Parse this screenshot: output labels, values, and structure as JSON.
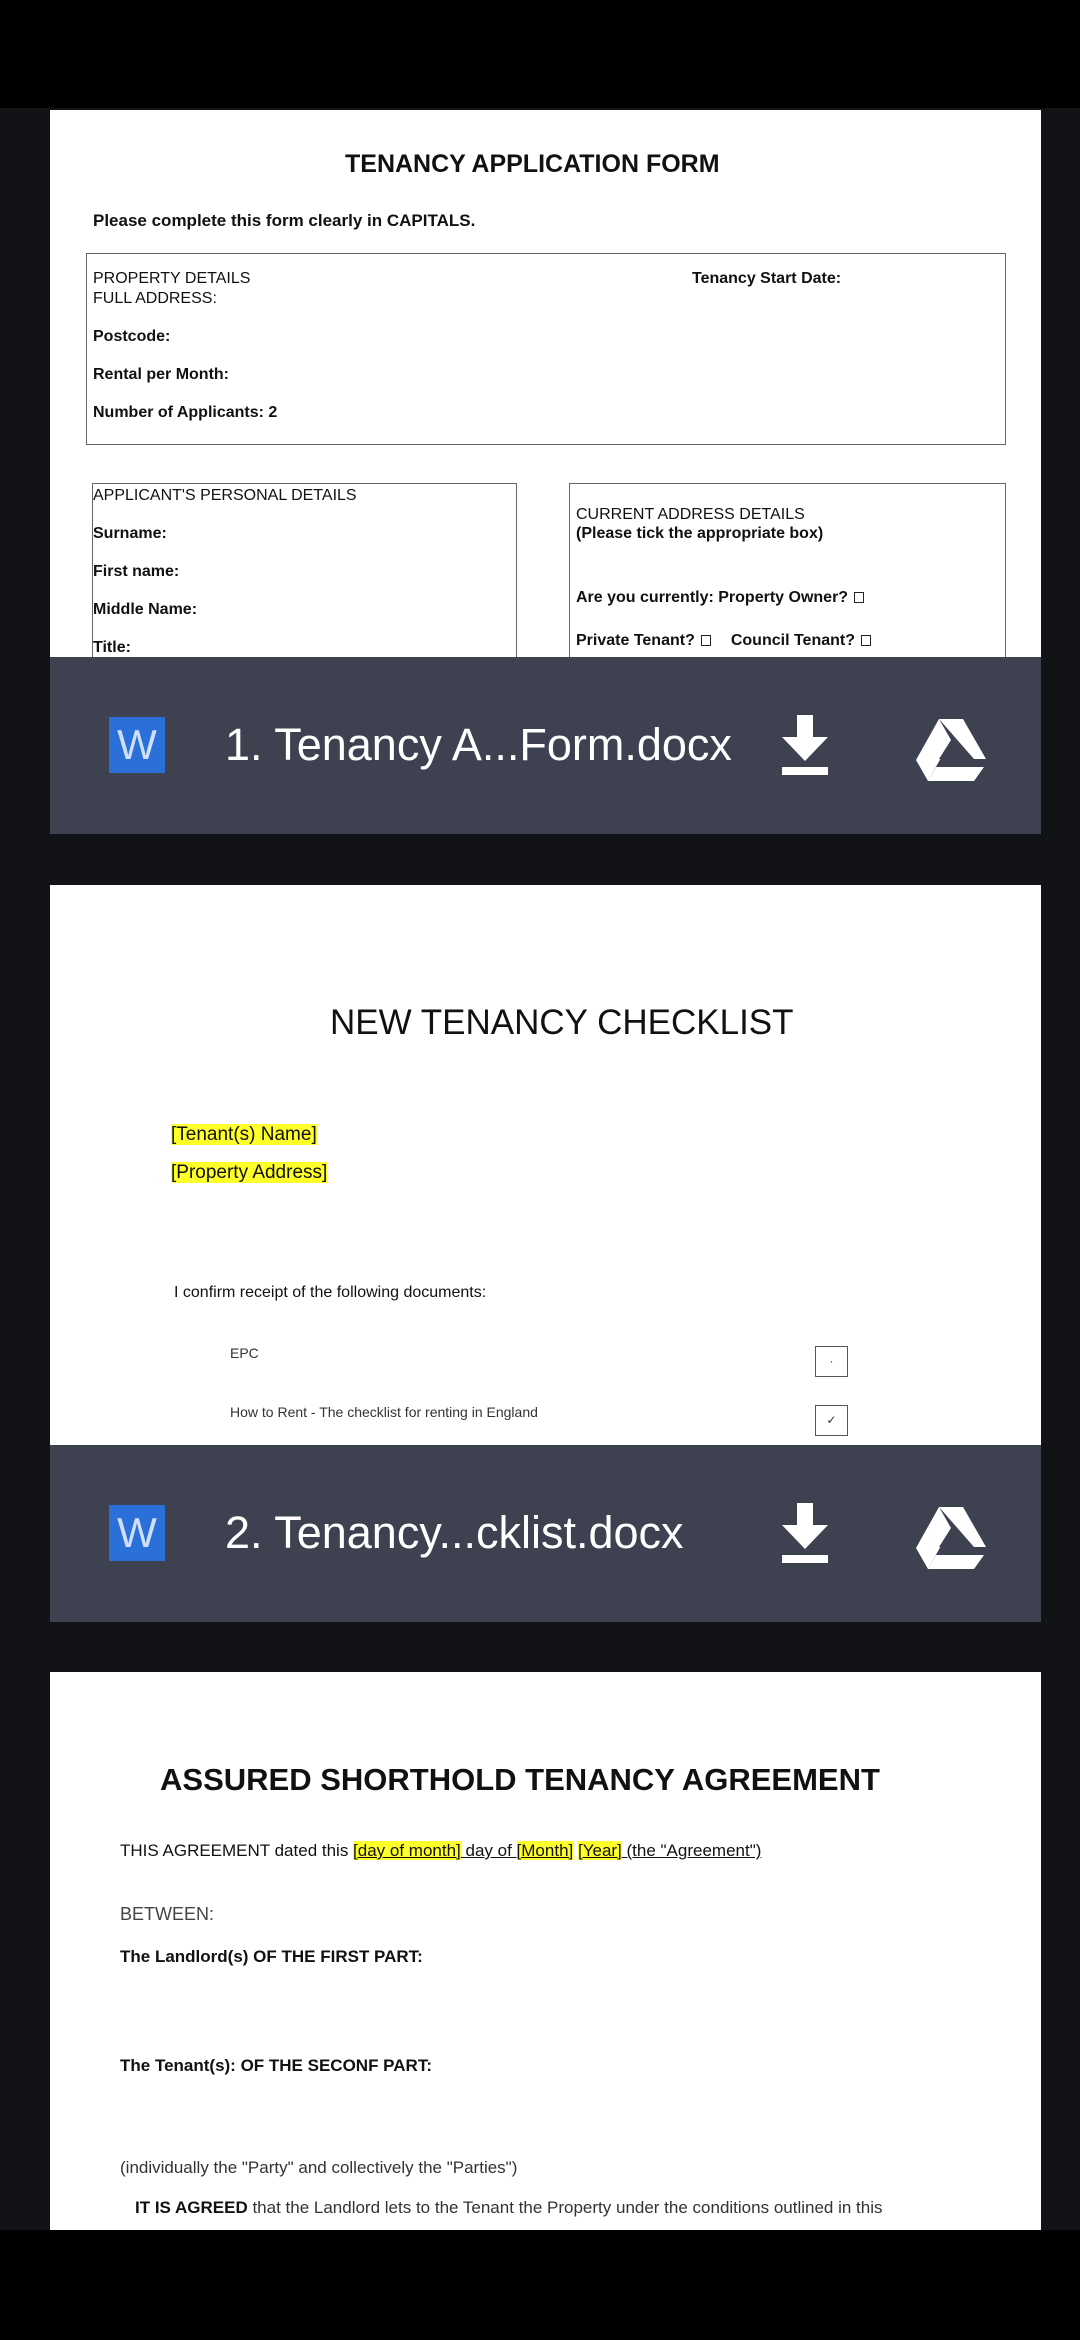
{
  "attachments": [
    {
      "filename": "1. Tenancy A...Form.docx",
      "type_icon": "W",
      "preview": {
        "title": "TENANCY APPLICATION FORM",
        "instruction": "Please complete this form clearly in CAPITALS.",
        "property": {
          "heading": "PROPERTY DETAILS",
          "address": "FULL ADDRESS:",
          "start_date": "Tenancy Start Date:",
          "postcode": "Postcode:",
          "rental": "Rental per Month:",
          "applicants": "Number of Applicants: 2"
        },
        "personal": {
          "heading": "APPLICANT'S PERSONAL DETAILS",
          "surname": "Surname:",
          "first_name": "First name:",
          "middle_name": "Middle Name:",
          "title": "Title:"
        },
        "current_address": {
          "heading": "CURRENT ADDRESS DETAILS",
          "subheading": "(Please tick the appropriate box)",
          "q1": "Are you currently:  Property Owner?",
          "q2": "Private Tenant?",
          "q3": "Council Tenant?"
        }
      }
    },
    {
      "filename": "2. Tenancy...cklist.docx",
      "type_icon": "W",
      "preview": {
        "title": "NEW TENANCY CHECKLIST",
        "tenant_name": "[Tenant(s) Name]",
        "property_address": "[Property Address]",
        "confirm": "I confirm receipt of the following documents:",
        "items": [
          "EPC",
          "How to Rent - The checklist for renting in England"
        ]
      }
    },
    {
      "preview": {
        "title": "ASSURED SHORTHOLD TENANCY AGREEMENT",
        "dated_prefix": "THIS AGREEMENT dated this ",
        "day": "[day of month]",
        "day_of": " day of ",
        "month": "[Month]",
        "year": "[Year]",
        "dated_suffix": " (the \"Agreement\")",
        "between": "BETWEEN:",
        "landlord": "The Landlord(s) OF THE FIRST PART:",
        "tenant": "The Tenant(s): OF THE SECONF PART:",
        "parties": "(individually the \"Party\" and collectively the \"Parties\")",
        "agreed_bold": "IT IS AGREED",
        "agreed_rest": " that the Landlord lets to the Tenant the Property under the conditions outlined in this"
      }
    }
  ],
  "colors": {
    "background": "#121316",
    "attachment_bar": "#3d4150",
    "word_icon": "#2b6fd8",
    "highlight": "#ffff2a"
  },
  "icons": [
    "word-file-icon",
    "download-icon",
    "google-drive-icon"
  ]
}
